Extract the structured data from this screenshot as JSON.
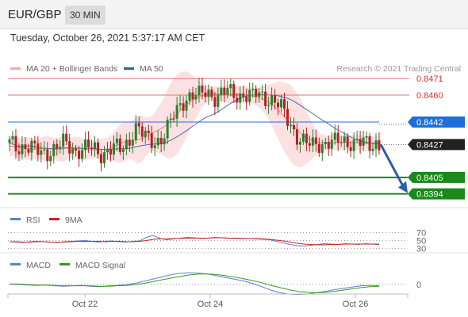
{
  "header": {
    "pair": "EUR/GBP",
    "timeframe": "30 MIN"
  },
  "datetime": "Tuesday, October 26, 2021 5:37:17 AM CET",
  "colors": {
    "candle_up": "#2e7d2e",
    "candle_down": "#b22222",
    "bollinger": "#f4a8a8",
    "ma20": "#f08080",
    "ma50": "#4a6fa5",
    "resistance": "#e57373",
    "pivot": "#1e6fd9",
    "support": "#1a8a1a",
    "current": "#222222",
    "arrow": "#2c5fa3",
    "rsi": "#5b7fd4",
    "rsi_ma": "#cc2222",
    "macd": "#5b7fd4",
    "macd_signal": "#3a9a1a"
  },
  "chart_data": [
    {
      "type": "candlestick",
      "title": "EUR/GBP",
      "ylim": [
        0.8388,
        0.8478
      ],
      "legend": [
        {
          "name": "MA 20 + Bollinger Bands",
          "color": "#f4a8a8"
        },
        {
          "name": "MA 50",
          "color": "#2c5fa3"
        }
      ],
      "credit": "Research © 2021 Trading Central",
      "levels": [
        {
          "value": 0.8471,
          "label": "0.8471",
          "kind": "resistance"
        },
        {
          "value": 0.846,
          "label": "0.8460",
          "kind": "resistance"
        },
        {
          "value": 0.8442,
          "label": "0.8442",
          "kind": "pivot"
        },
        {
          "value": 0.8427,
          "label": "0.8427",
          "kind": "current"
        },
        {
          "value": 0.8405,
          "label": "0.8405",
          "kind": "support"
        },
        {
          "value": 0.8394,
          "label": "0.8394",
          "kind": "support"
        }
      ],
      "x_ticks": [
        "Oct 22",
        "Oct 24",
        "Oct 26"
      ],
      "close_path": [
        0.8428,
        0.8426,
        0.8424,
        0.8425,
        0.8427,
        0.8426,
        0.8424,
        0.8422,
        0.842,
        0.8421,
        0.8423,
        0.8425,
        0.8427,
        0.8428,
        0.8426,
        0.8424,
        0.8422,
        0.8424,
        0.8425,
        0.8426,
        0.8424,
        0.8422,
        0.842,
        0.8421,
        0.8424,
        0.8426,
        0.8425,
        0.8423,
        0.8425,
        0.8428,
        0.8436,
        0.844,
        0.8436,
        0.8432,
        0.8429,
        0.8428,
        0.8429,
        0.8432,
        0.8436,
        0.8441,
        0.8446,
        0.845,
        0.8455,
        0.8458,
        0.846,
        0.8461,
        0.8459,
        0.8461,
        0.8462,
        0.846,
        0.8459,
        0.846,
        0.8462,
        0.8463,
        0.8461,
        0.846,
        0.8459,
        0.8461,
        0.846,
        0.8459,
        0.8461,
        0.846,
        0.8458,
        0.8458,
        0.8457,
        0.8455,
        0.8452,
        0.8447,
        0.8442,
        0.8437,
        0.8433,
        0.843,
        0.8428,
        0.8427,
        0.8426,
        0.8428,
        0.8427,
        0.8428,
        0.8429,
        0.8428,
        0.8429,
        0.843,
        0.8428,
        0.8429,
        0.8428,
        0.8429,
        0.8428,
        0.8427,
        0.8426,
        0.8428,
        0.8427
      ]
    },
    {
      "type": "line",
      "title": "RSI",
      "legend": [
        {
          "name": "RSI",
          "color": "#5b7fd4"
        },
        {
          "name": "9MA",
          "color": "#cc2222"
        }
      ],
      "ylim": [
        25,
        75
      ],
      "y_ticks": [
        70,
        50,
        30
      ],
      "series": [
        {
          "name": "RSI",
          "values": [
            47,
            46,
            45,
            47,
            48,
            47,
            46,
            45,
            47,
            48,
            49,
            50,
            48,
            46,
            48,
            49,
            47,
            46,
            48,
            49,
            58,
            63,
            55,
            52,
            54,
            56,
            58,
            57,
            55,
            56,
            58,
            57,
            56,
            55,
            54,
            55,
            54,
            53,
            52,
            48,
            44,
            40,
            37,
            36,
            38,
            40,
            42,
            41,
            40,
            42,
            41,
            40,
            42,
            41,
            39
          ]
        },
        {
          "name": "9MA",
          "values": [
            47,
            47,
            46,
            46,
            47,
            47,
            46,
            46,
            46,
            47,
            48,
            48,
            48,
            48,
            47,
            48,
            48,
            47,
            47,
            48,
            50,
            53,
            54,
            54,
            55,
            55,
            56,
            56,
            56,
            56,
            57,
            57,
            56,
            56,
            55,
            55,
            55,
            54,
            53,
            51,
            49,
            46,
            43,
            41,
            40,
            39,
            39,
            40,
            40,
            41,
            41,
            41,
            41,
            41,
            41
          ]
        }
      ]
    },
    {
      "type": "line",
      "title": "MACD",
      "legend": [
        {
          "name": "MACD",
          "color": "#5b7fd4"
        },
        {
          "name": "MACD Signal",
          "color": "#3a9a1a"
        }
      ],
      "y_ticks": [
        0
      ],
      "series": [
        {
          "name": "MACD",
          "values": [
            0.1,
            0.0,
            -0.1,
            -0.2,
            -0.1,
            -0.3,
            -0.4,
            -0.3,
            -0.2,
            -0.4,
            -0.5,
            -0.3,
            -0.2,
            0.0,
            0.3,
            0.8,
            1.3,
            1.8,
            2.3,
            2.6,
            2.7,
            2.6,
            2.4,
            2.0,
            1.6,
            1.2,
            0.8,
            0.2,
            -0.5,
            -1.3,
            -1.9,
            -2.2,
            -2.3,
            -2.2,
            -1.9,
            -1.6,
            -1.2,
            -0.9,
            -0.6,
            -0.3,
            -0.2,
            -0.3
          ]
        },
        {
          "name": "MACD Signal",
          "values": [
            0.1,
            0.1,
            0.0,
            -0.1,
            -0.1,
            -0.2,
            -0.3,
            -0.3,
            -0.3,
            -0.3,
            -0.4,
            -0.4,
            -0.3,
            -0.2,
            0.0,
            0.3,
            0.7,
            1.1,
            1.5,
            1.9,
            2.2,
            2.4,
            2.4,
            2.3,
            2.0,
            1.7,
            1.3,
            0.9,
            0.4,
            -0.2,
            -0.7,
            -1.2,
            -1.6,
            -1.8,
            -1.9,
            -1.8,
            -1.6,
            -1.3,
            -1.0,
            -0.7,
            -0.5,
            -0.4
          ]
        }
      ]
    }
  ]
}
